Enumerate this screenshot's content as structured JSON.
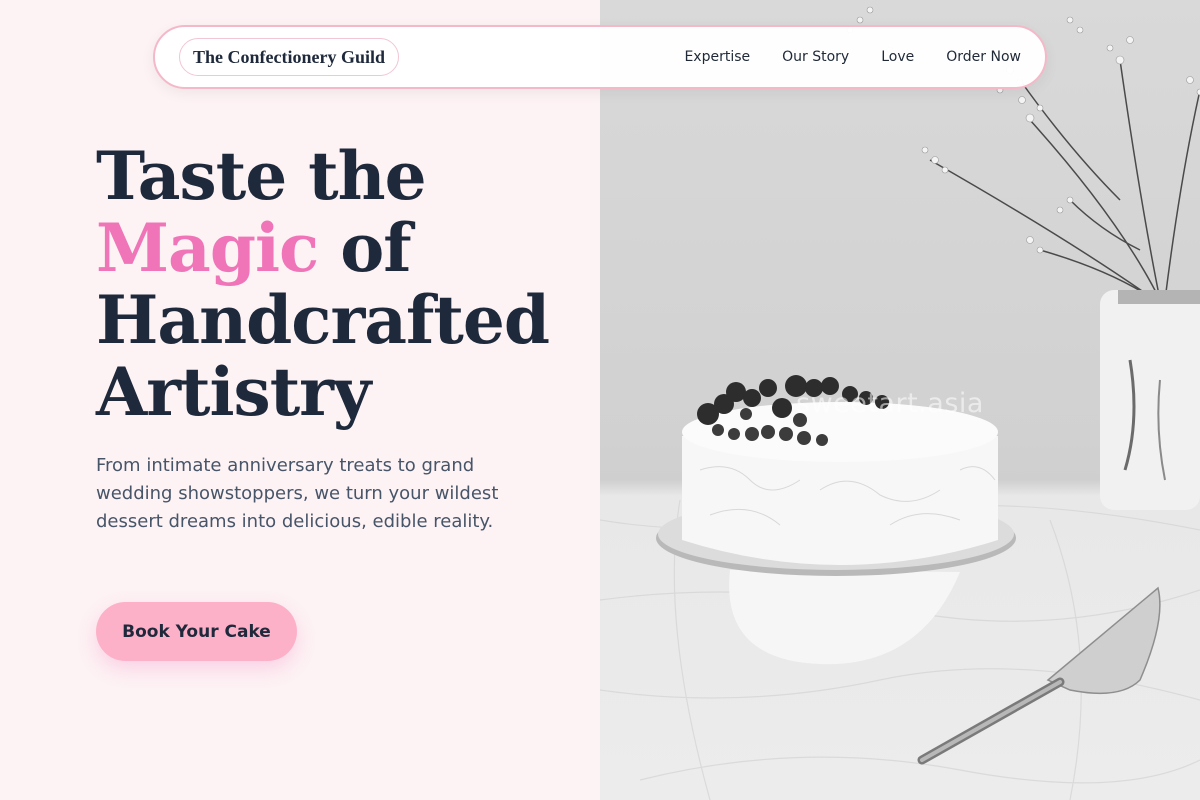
{
  "nav": {
    "brand": "The Confectionery Guild",
    "links": [
      "Expertise",
      "Our Story",
      "Love",
      "Order Now"
    ]
  },
  "hero": {
    "title_line1": "Taste the",
    "title_accent": "Magic",
    "title_line2_rest": " of",
    "title_line3": "Handcrafted",
    "title_line4": "Artistry",
    "description": "From intimate anniversary treats to grand wedding showstoppers, we turn your wildest dessert dreams into delicious, edible reality.",
    "cta_label": "Book Your Cake"
  },
  "image": {
    "watermark": "sweetart.asia"
  },
  "colors": {
    "background": "#fdf2f4",
    "accent": "#f075b8",
    "button": "#fdb1c8",
    "heading": "#1e293b",
    "body_text": "#475569",
    "nav_border": "#f5b8c8"
  },
  "icons": [
    "flowers-in-vase",
    "cake-on-stand",
    "cake-server"
  ]
}
